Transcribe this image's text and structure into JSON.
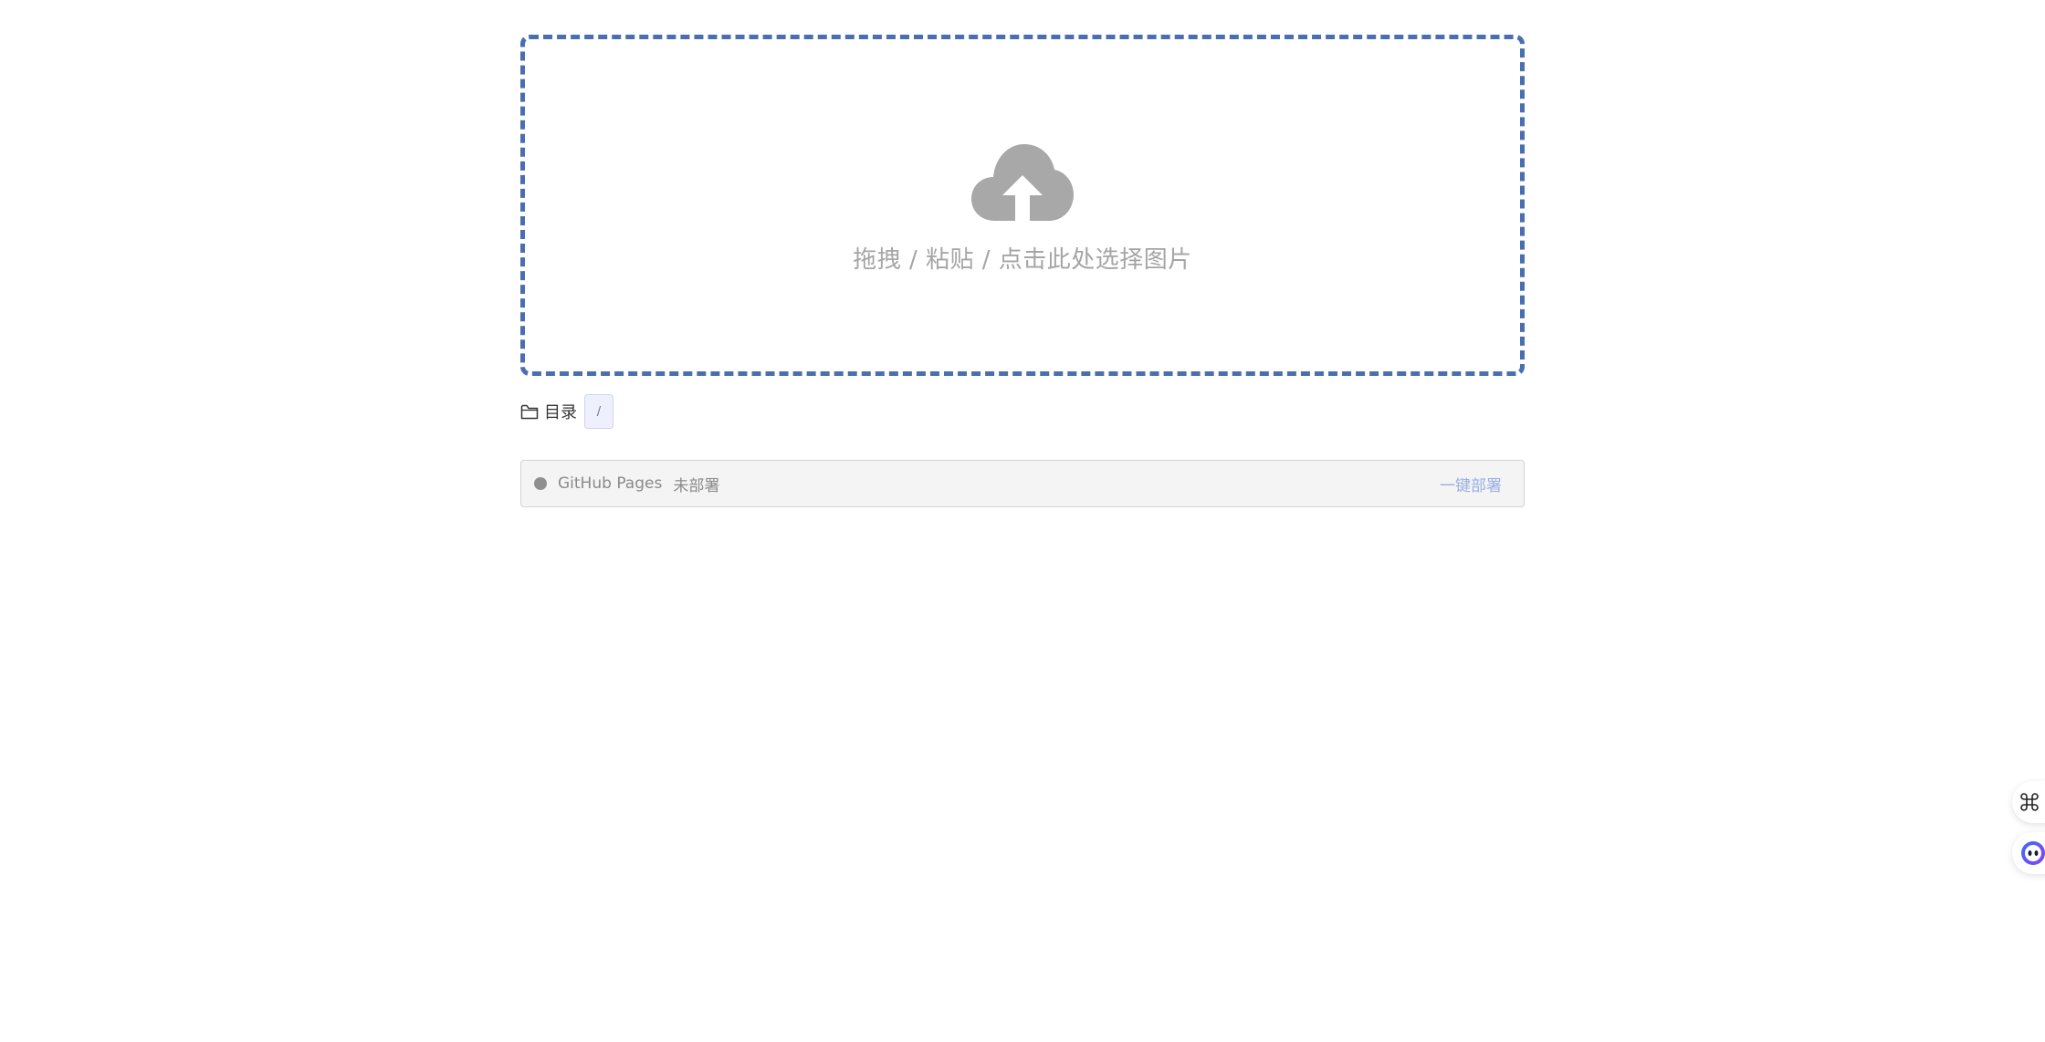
{
  "dropzone": {
    "icon": "cloud-upload-icon",
    "text": "拖拽 / 粘贴 / 点击此处选择图片",
    "border_color": "#4a6fb1",
    "text_color": "#a5a5a5"
  },
  "directory": {
    "icon": "folder-icon",
    "label": "目录",
    "value": "/"
  },
  "deploy": {
    "name": "GitHub Pages",
    "status": "未部署",
    "button_label": "一键部署",
    "status_dot_color": "#8f8f8f",
    "button_color": "#99aee2"
  },
  "side_tools": [
    {
      "icon": "command-icon"
    },
    {
      "icon": "assistant-icon"
    }
  ]
}
